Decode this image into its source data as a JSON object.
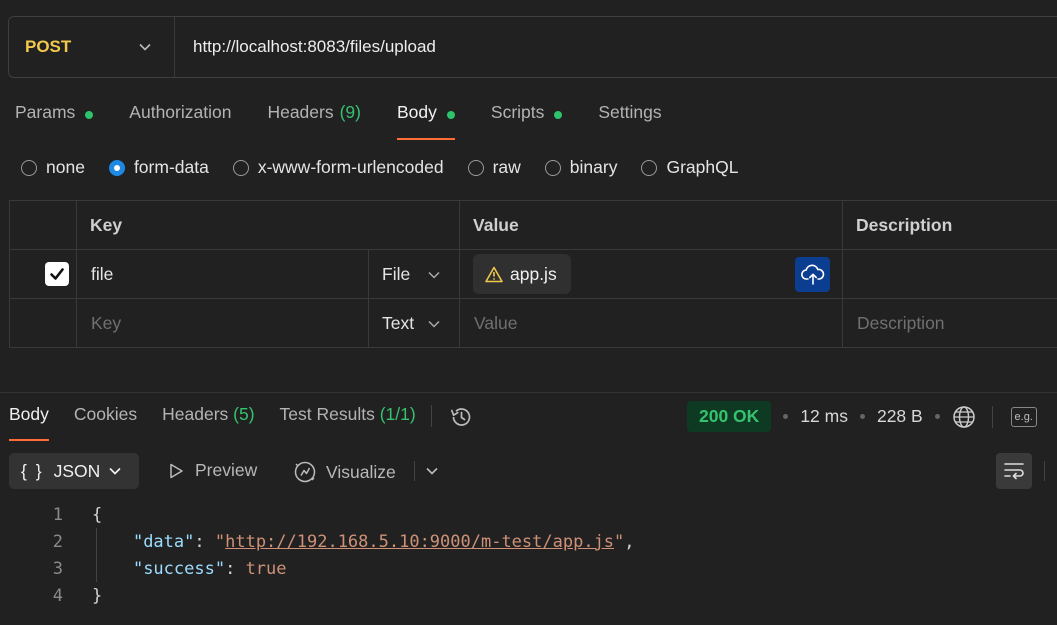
{
  "request": {
    "method": "POST",
    "url": "http://localhost:8083/files/upload"
  },
  "request_tabs": [
    {
      "label": "Params",
      "dot": true
    },
    {
      "label": "Authorization"
    },
    {
      "label": "Headers",
      "count": "(9)"
    },
    {
      "label": "Body",
      "dot": true,
      "active": true
    },
    {
      "label": "Scripts",
      "dot": true
    },
    {
      "label": "Settings"
    }
  ],
  "body_types": [
    {
      "label": "none"
    },
    {
      "label": "form-data",
      "selected": true
    },
    {
      "label": "x-www-form-urlencoded"
    },
    {
      "label": "raw"
    },
    {
      "label": "binary"
    },
    {
      "label": "GraphQL"
    }
  ],
  "form_table": {
    "headers": {
      "key": "Key",
      "value": "Value",
      "description": "Description"
    },
    "rows": [
      {
        "checked": true,
        "key": "file",
        "type": "File",
        "value": "app.js"
      }
    ],
    "new_row": {
      "key_placeholder": "Key",
      "type": "Text",
      "value_placeholder": "Value",
      "description_placeholder": "Description"
    }
  },
  "response_tabs": [
    {
      "label": "Body",
      "active": true
    },
    {
      "label": "Cookies"
    },
    {
      "label": "Headers",
      "count": "(5)"
    },
    {
      "label": "Test Results",
      "count": "(1/1)"
    }
  ],
  "response_meta": {
    "status": "200 OK",
    "time": "12 ms",
    "size": "228 B",
    "example_label": "e.g."
  },
  "response_toolbar": {
    "format": "JSON",
    "format_icon": "{ }",
    "preview": "Preview",
    "visualize": "Visualize"
  },
  "code_lines": [
    {
      "n": "1",
      "parts": [
        {
          "t": "{",
          "c": "punct"
        }
      ]
    },
    {
      "n": "2",
      "parts": [
        {
          "t": "    "
        },
        {
          "t": "\"data\"",
          "c": "key"
        },
        {
          "t": ": "
        },
        {
          "t": "\"",
          "c": "str"
        },
        {
          "t": "http://192.168.5.10:9000/m-test/app.js",
          "c": "url-str"
        },
        {
          "t": "\"",
          "c": "str"
        },
        {
          "t": ","
        }
      ]
    },
    {
      "n": "3",
      "parts": [
        {
          "t": "    "
        },
        {
          "t": "\"success\"",
          "c": "key"
        },
        {
          "t": ": "
        },
        {
          "t": "true",
          "c": "bool"
        }
      ]
    },
    {
      "n": "4",
      "parts": [
        {
          "t": "}",
          "c": "punct"
        }
      ]
    }
  ],
  "colors": {
    "accent": "#ff6c37",
    "method": "#f2c94c",
    "success": "#36c26e",
    "upload_button": "#0b3d91"
  }
}
